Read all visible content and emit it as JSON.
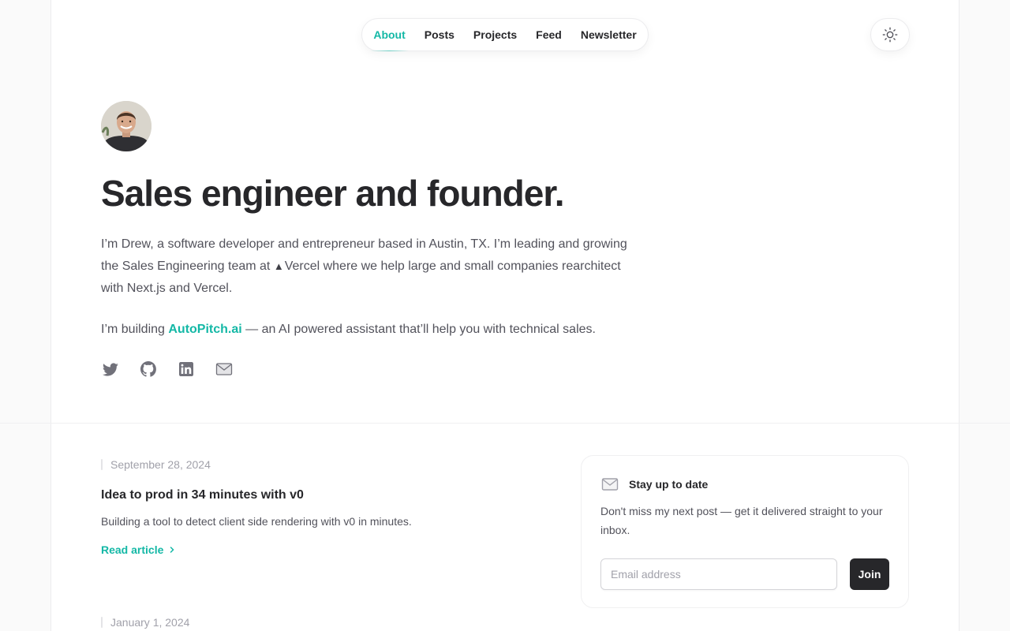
{
  "nav": {
    "items": [
      {
        "label": "About",
        "active": true
      },
      {
        "label": "Posts",
        "active": false
      },
      {
        "label": "Projects",
        "active": false
      },
      {
        "label": "Feed",
        "active": false
      },
      {
        "label": "Newsletter",
        "active": false
      }
    ],
    "theme_icon": "sun-icon"
  },
  "hero": {
    "title": "Sales engineer and founder.",
    "bio_1_part_1": "I’m Drew, a software developer and entrepreneur based in Austin, TX. I’m leading and growing the Sales Engineering team at ",
    "vercel_symbol": "▲",
    "bio_1_part_2": "Vercel where we help large and small companies rearchitect with Next.js and Vercel.",
    "bio_2_part_1": "I’m building ",
    "bio_2_link": "AutoPitch.ai",
    "bio_2_part_2": " — an AI powered assistant that’ll help you with technical sales."
  },
  "socials": [
    "twitter-icon",
    "github-icon",
    "linkedin-icon",
    "mail-icon"
  ],
  "articles": [
    {
      "date": "September 28, 2024",
      "title": "Idea to prod in 34 minutes with v0",
      "summary": "Building a tool to detect client side rendering with v0 in minutes.",
      "cta": "Read article"
    },
    {
      "date": "January 1, 2024"
    }
  ],
  "newsletter": {
    "title": "Stay up to date",
    "text": "Don't miss my next post — get it delivered straight to your inbox.",
    "placeholder": "Email address",
    "button": "Join"
  },
  "colors": {
    "accent": "#14b8a6",
    "text": "#27272a",
    "muted": "#52525b"
  }
}
